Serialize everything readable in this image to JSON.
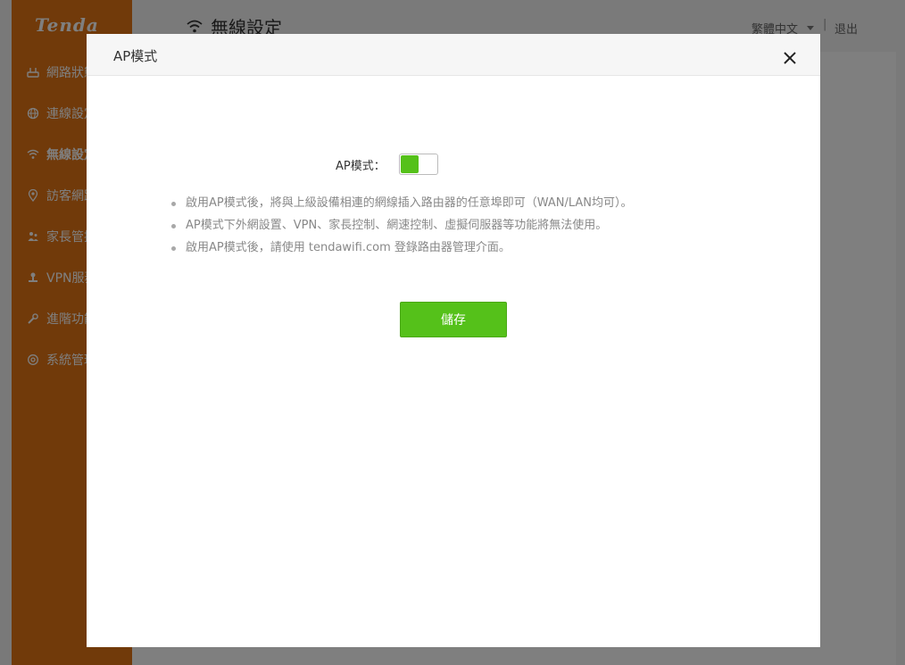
{
  "app": {
    "logo": "Tenda"
  },
  "sidebar": {
    "items": [
      {
        "label": "網路狀態",
        "icon": "router-icon"
      },
      {
        "label": "連線設定",
        "icon": "globe-icon"
      },
      {
        "label": "無線設定",
        "icon": "wifi-icon",
        "active": true
      },
      {
        "label": "訪客網路",
        "icon": "location-icon"
      },
      {
        "label": "家長管控",
        "icon": "family-icon"
      },
      {
        "label": "VPN服務",
        "icon": "vpn-icon"
      },
      {
        "label": "進階功能",
        "icon": "wrench-icon"
      },
      {
        "label": "系統管理",
        "icon": "gear-icon"
      }
    ]
  },
  "header": {
    "title": "無線設定",
    "language": "繁體中文",
    "separator": "|",
    "logout": "退出"
  },
  "modal": {
    "title": "AP模式",
    "toggle_label": "AP模式：",
    "toggle_on": true,
    "notes": [
      "啟用AP模式後，將與上級設備相連的網線插入路由器的任意埠即可（WAN/LAN均可）。",
      "AP模式下外網設置、VPN、家長控制、網速控制、虛擬伺服器等功能將無法使用。",
      "啟用AP模式後，請使用 tendawifi.com 登錄路由器管理介面。"
    ],
    "save_label": "儲存"
  },
  "colors": {
    "sidebar_bg": "#e37414",
    "accent_green": "#55c11a",
    "overlay": "rgba(0,0,0,0.5)"
  }
}
